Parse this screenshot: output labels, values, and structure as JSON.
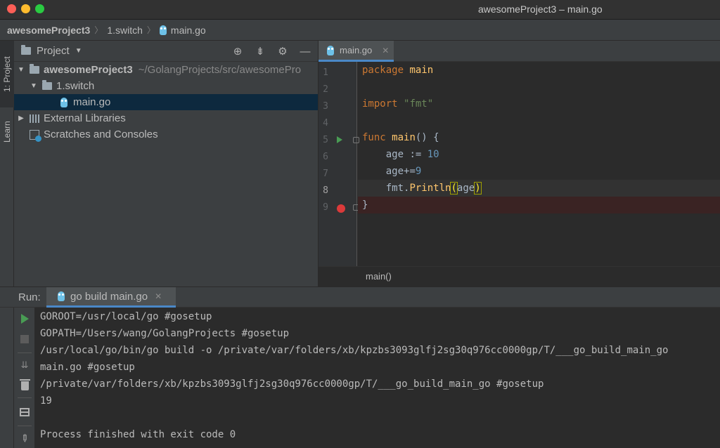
{
  "window": {
    "title": "awesomeProject3 – main.go",
    "colors": {
      "close": "#fd5f57",
      "minimize": "#febb2e",
      "zoom": "#2acb42"
    }
  },
  "breadcrumb": {
    "project": "awesomeProject3",
    "folder": "1.switch",
    "file": "main.go"
  },
  "left_strip": {
    "project_tab": "1: Project",
    "learn_tab": "Learn"
  },
  "project_panel": {
    "title": "Project",
    "tree": {
      "root_name": "awesomeProject3",
      "root_path": "~/GolangProjects/src/awesomePro",
      "folder": "1.switch",
      "file": "main.go",
      "external_libraries": "External Libraries",
      "scratches": "Scratches and Consoles"
    }
  },
  "editor": {
    "tab_label": "main.go",
    "line_numbers": [
      "1",
      "2",
      "3",
      "4",
      "5",
      "6",
      "7",
      "8",
      "9"
    ],
    "code": {
      "l1_kw": "package",
      "l1_name": "main",
      "l3_kw": "import",
      "l3_str": "\"fmt\"",
      "l5_kw": "func",
      "l5_fn": "main",
      "l5_rest": "() {",
      "l6_var": "age",
      "l6_op": " := ",
      "l6_num": "10",
      "l7_var": "age",
      "l7_op": "+=",
      "l7_num": "9",
      "l8_pkg": "fmt",
      "l8_dot": ".",
      "l8_fn": "Println",
      "l8_open": "(",
      "l8_arg": "age",
      "l8_close": ")",
      "l9_brace": "}"
    },
    "status_context": "main()"
  },
  "run_panel": {
    "label": "Run:",
    "tab_label": "go build main.go",
    "output": [
      "GOROOT=/usr/local/go #gosetup",
      "GOPATH=/Users/wang/GolangProjects #gosetup",
      "/usr/local/go/bin/go build -o /private/var/folders/xb/kpzbs3093glfj2sg30q976cc0000gp/T/___go_build_main_go",
      "main.go #gosetup",
      "/private/var/folders/xb/kpzbs3093glfj2sg30q976cc0000gp/T/___go_build_main_go #gosetup",
      "19",
      "",
      "Process finished with exit code 0"
    ]
  },
  "icons": {
    "run": "play-icon",
    "stop": "stop-icon",
    "breakpoint": "breakpoint-icon"
  }
}
